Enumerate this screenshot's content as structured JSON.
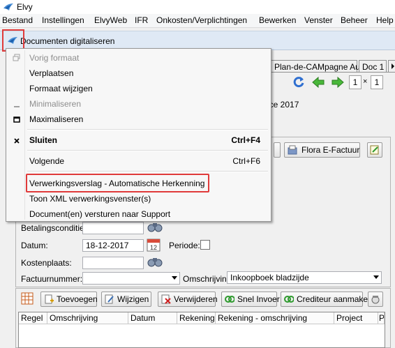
{
  "app": {
    "title": "Elvy"
  },
  "menubar": [
    "Bestand",
    "Instellingen",
    "ElvyWeb",
    "IFR",
    "Onkosten/Verplichtingen",
    "Bewerken",
    "Venster",
    "Beheer",
    "Help"
  ],
  "child_window": {
    "title": "Documenten digitaliseren"
  },
  "tabs": [
    "Plan-de-CAMpagne Auto",
    "Doc 1"
  ],
  "nav": {
    "page": "1",
    "separator": "×",
    "total": "1"
  },
  "partial_text": "ice 2017",
  "buttons_top": {
    "flora": "Flora E-Factuur"
  },
  "form": {
    "betalingsconditie_label": "Betalingsconditie:",
    "datum_label": "Datum:",
    "datum_value": "18-12-2017",
    "periode_label": "Periode:",
    "kostenplaats_label": "Kostenplaats:",
    "factuurnummer_label": "Factuurnummer:",
    "factuurnummer_value": "",
    "omschrijving_label": "Omschrijving:",
    "omschrijving_value": "Inkoopboek bladzijde"
  },
  "toolbar": {
    "toevoegen": "Toevoegen",
    "wijzigen": "Wijzigen",
    "verwijderen": "Verwijderen",
    "snel_invoer": "Snel Invoer",
    "crediteur_aanmaken": "Crediteur aanmaken"
  },
  "grid": {
    "columns": [
      "Regel",
      "Omschrijving",
      "Datum",
      "Rekening",
      "Rekening - omschrijving",
      "Project",
      "P"
    ]
  },
  "context_menu": {
    "items": [
      {
        "label": "Vorig formaat",
        "shortcut": "",
        "disabled": true,
        "icon": "restore-icon"
      },
      {
        "label": "Verplaatsen",
        "shortcut": "",
        "disabled": false,
        "icon": ""
      },
      {
        "label": "Formaat wijzigen",
        "shortcut": "",
        "disabled": false,
        "icon": ""
      },
      {
        "label": "Minimaliseren",
        "shortcut": "",
        "disabled": true,
        "icon": "minimize-icon"
      },
      {
        "label": "Maximaliseren",
        "shortcut": "",
        "disabled": false,
        "icon": "maximize-icon"
      },
      {
        "label": "Sluiten",
        "shortcut": "Ctrl+F4",
        "disabled": false,
        "icon": "close-icon"
      },
      {
        "label": "Volgende",
        "shortcut": "Ctrl+F6",
        "disabled": false,
        "icon": ""
      },
      {
        "label": "Verwerkingsverslag - Automatische Herkenning",
        "shortcut": "",
        "disabled": false,
        "icon": ""
      },
      {
        "label": "Toon XML verwerkingsvenster(s)",
        "shortcut": "",
        "disabled": false,
        "icon": ""
      },
      {
        "label": "Document(en) versturen naar Support",
        "shortcut": "",
        "disabled": false,
        "icon": ""
      }
    ]
  },
  "colors": {
    "highlight": "#e03a3a",
    "child_title_bg": "#dfe9f5"
  }
}
